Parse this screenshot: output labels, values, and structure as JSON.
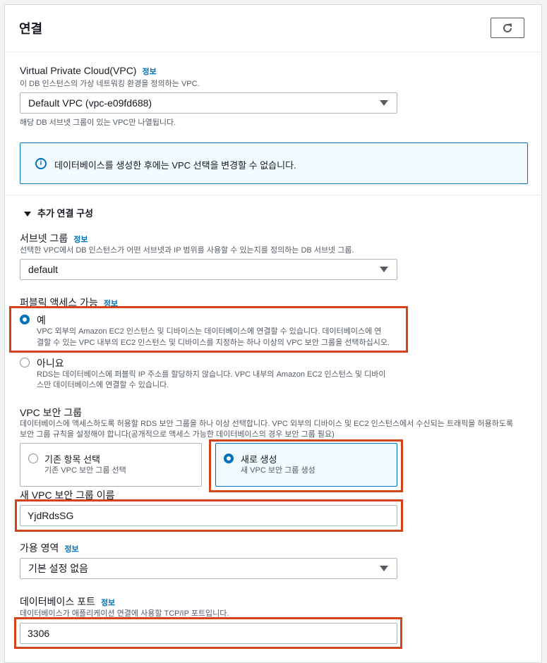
{
  "section": {
    "title": "연결"
  },
  "vpc": {
    "label": "Virtual Private Cloud(VPC)",
    "info": "정보",
    "description": "이 DB 인스턴스의 가상 네트워킹 환경을 정의하는 VPC.",
    "selected": "Default VPC (vpc-e09fd688)",
    "help": "해당 DB 서브넷 그룹이 있는 VPC만 나열됩니다."
  },
  "alert": {
    "text": "데이터베이스를 생성한 후에는 VPC 선택을 변경할 수 없습니다."
  },
  "additional": {
    "toggle_label": "추가 연결 구성"
  },
  "subnet": {
    "label": "서브넷 그룹",
    "info": "정보",
    "description": "선택한 VPC에서 DB 인스턴스가 어떤 서브넷과 IP 범위를 사용할 수 있는지를 정의하는 DB 서브넷 그룹.",
    "selected": "default"
  },
  "public_access": {
    "label": "퍼블릭 액세스 가능",
    "info": "정보",
    "yes_label": "예",
    "yes_desc_1": "VPC 외부의 Amazon EC2 인스턴스 및 디바이스는 데이터베이스에 연결할 수 있습니다. 데이터베이스에 연",
    "yes_desc_2": "결할 수 있는 VPC 내부의 EC2 인스턴스 및 디바이스를 지정하는 하나 이상의 VPC 보안 그룹을 선택하십시오.",
    "no_label": "아니요",
    "no_desc_1": "RDS는 데이터베이스에 퍼블릭 IP 주소를 할당하지 않습니다. VPC 내부의 Amazon EC2 인스턴스 및 디바이",
    "no_desc_2": "스만 데이터베이스에 연결할 수 있습니다."
  },
  "security_group": {
    "label": "VPC 보안 그룹",
    "description_1": "데이터베이스에 액세스하도록 허용할 RDS 보안 그룹을 하나 이상 선택합니다. VPC 외부의 디바이스 및 EC2 인스턴스에서 수신되는 트래픽을 허용하도록",
    "description_2": "보안 그룹 규칙을 설정해야 합니다(공개적으로 액세스 가능한 데이터베이스의 경우 보안 그룹 필요)",
    "existing_label": "기존 항목 선택",
    "existing_desc": "기존 VPC 보안 그룹 선택",
    "new_label": "새로 생성",
    "new_desc": "새 VPC 보안 그룹 생성"
  },
  "new_sg_name": {
    "label": "새 VPC 보안 그룹 이름",
    "value": "YjdRdsSG"
  },
  "availability_zone": {
    "label": "가용 영역",
    "info": "정보",
    "selected": "기본 설정 없음"
  },
  "db_port": {
    "label": "데이터베이스 포트",
    "info": "정보",
    "description": "데이터베이스가 애플리케이션 연결에 사용할 TCP/IP 포트입니다.",
    "value": "3306"
  },
  "colors": {
    "accent": "#0073bb",
    "highlight": "#d4441b"
  }
}
